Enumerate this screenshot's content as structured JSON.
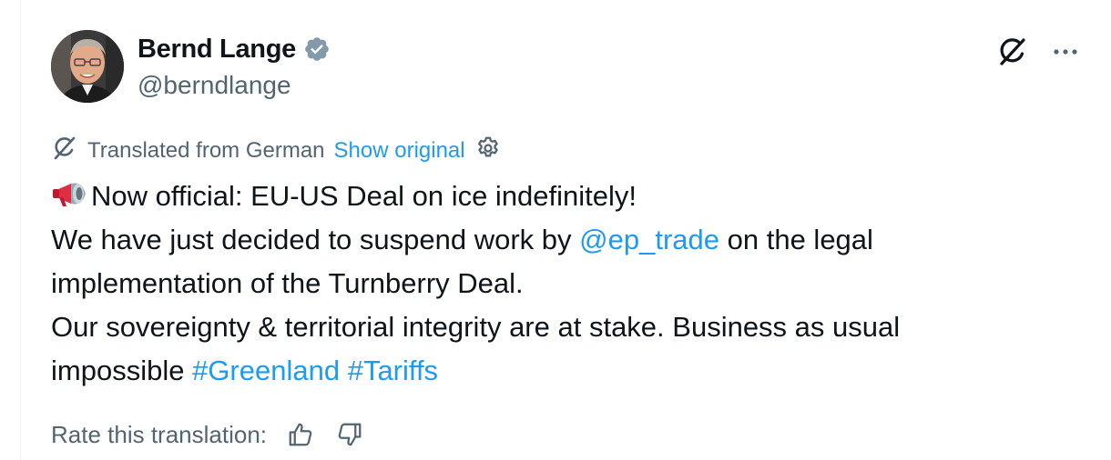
{
  "author": {
    "name": "Bernd Lange",
    "handle": "@berndlange",
    "verified": true
  },
  "header_actions": {
    "grok_icon": "grok-slash-icon",
    "more_icon": "more-dots-icon"
  },
  "translation": {
    "label": "Translated from German",
    "show_original": "Show original"
  },
  "tweet": {
    "line1_text": "Now official: EU-US Deal on ice indefinitely!",
    "line2_before": "We have just decided to suspend work by ",
    "line2_mention": "@ep_trade",
    "line2_after": " on the legal",
    "line3": "implementation of the Turnberry Deal.",
    "line4": "Our sovereignty & territorial integrity are at stake. Business as usual",
    "line5_before": "impossible ",
    "hashtag1": "#Greenland",
    "hashtag2": "#Tariffs"
  },
  "rating": {
    "label": "Rate this translation:"
  },
  "colors": {
    "link": "#1d9bf0",
    "secondary_text": "#536471",
    "primary_text": "#0f1419",
    "verified_badge": "#829aab"
  }
}
